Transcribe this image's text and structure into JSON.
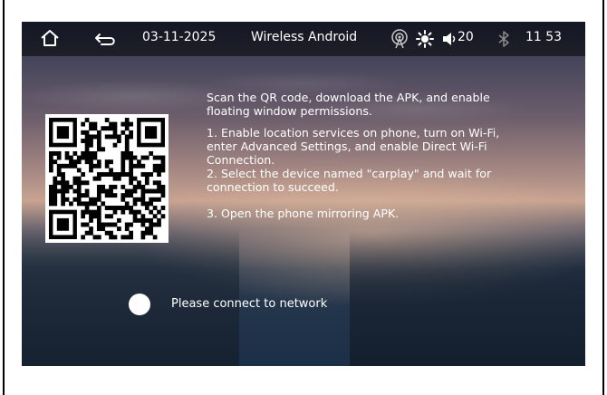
{
  "header_text": "",
  "statusbar": {
    "date": "03-11-2025",
    "title": "Wireless Android",
    "volume": "20",
    "time": "11 53",
    "icons": [
      "home-icon",
      "back-icon",
      "hotspot-icon",
      "brightness-icon",
      "volume-icon",
      "bluetooth-icon"
    ]
  },
  "instructions": {
    "intro": "Scan the QR code, download the APK, and enable floating window permissions.",
    "step1": "1. Enable location services on phone, turn on Wi-Fi, enter Advanced Settings, and enable Direct Wi-Fi Connection.",
    "step2": "2. Select the device named  \"carplay\"  and wait for connection to succeed.",
    "step3": "3. Open the phone mirroring APK."
  },
  "connection": {
    "status_text": "Please connect to network"
  },
  "colors": {
    "statusbar_bg": "#000000",
    "text": "#ffffff"
  }
}
